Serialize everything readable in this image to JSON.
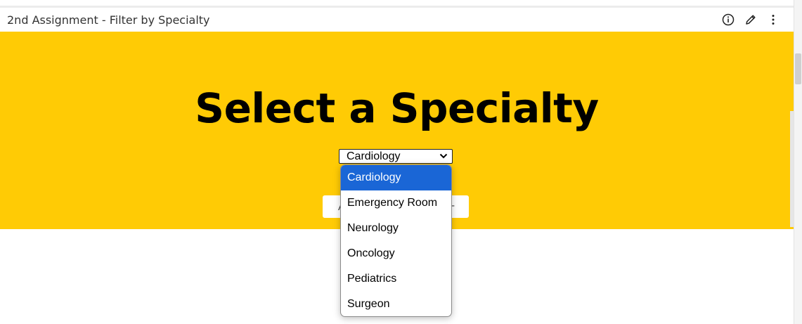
{
  "window": {
    "title": "2nd Assignment - Filter by Specialty",
    "actions": [
      {
        "name": "info-icon"
      },
      {
        "name": "edit-pencil-icon"
      },
      {
        "name": "more-vertical-icon"
      }
    ]
  },
  "banner": {
    "headline": "Select a Specialty",
    "background": "#FFCB05",
    "select": {
      "value": "Cardiology",
      "options": [
        "Cardiology",
        "Emergency Room",
        "Neurology",
        "Oncology",
        "Pediatrics",
        "Surgeon"
      ],
      "selected_index": 0,
      "highlight_color": "#1A66D6"
    },
    "button_peek": {
      "left_fragment": "A",
      "right_fragment": "-"
    }
  }
}
